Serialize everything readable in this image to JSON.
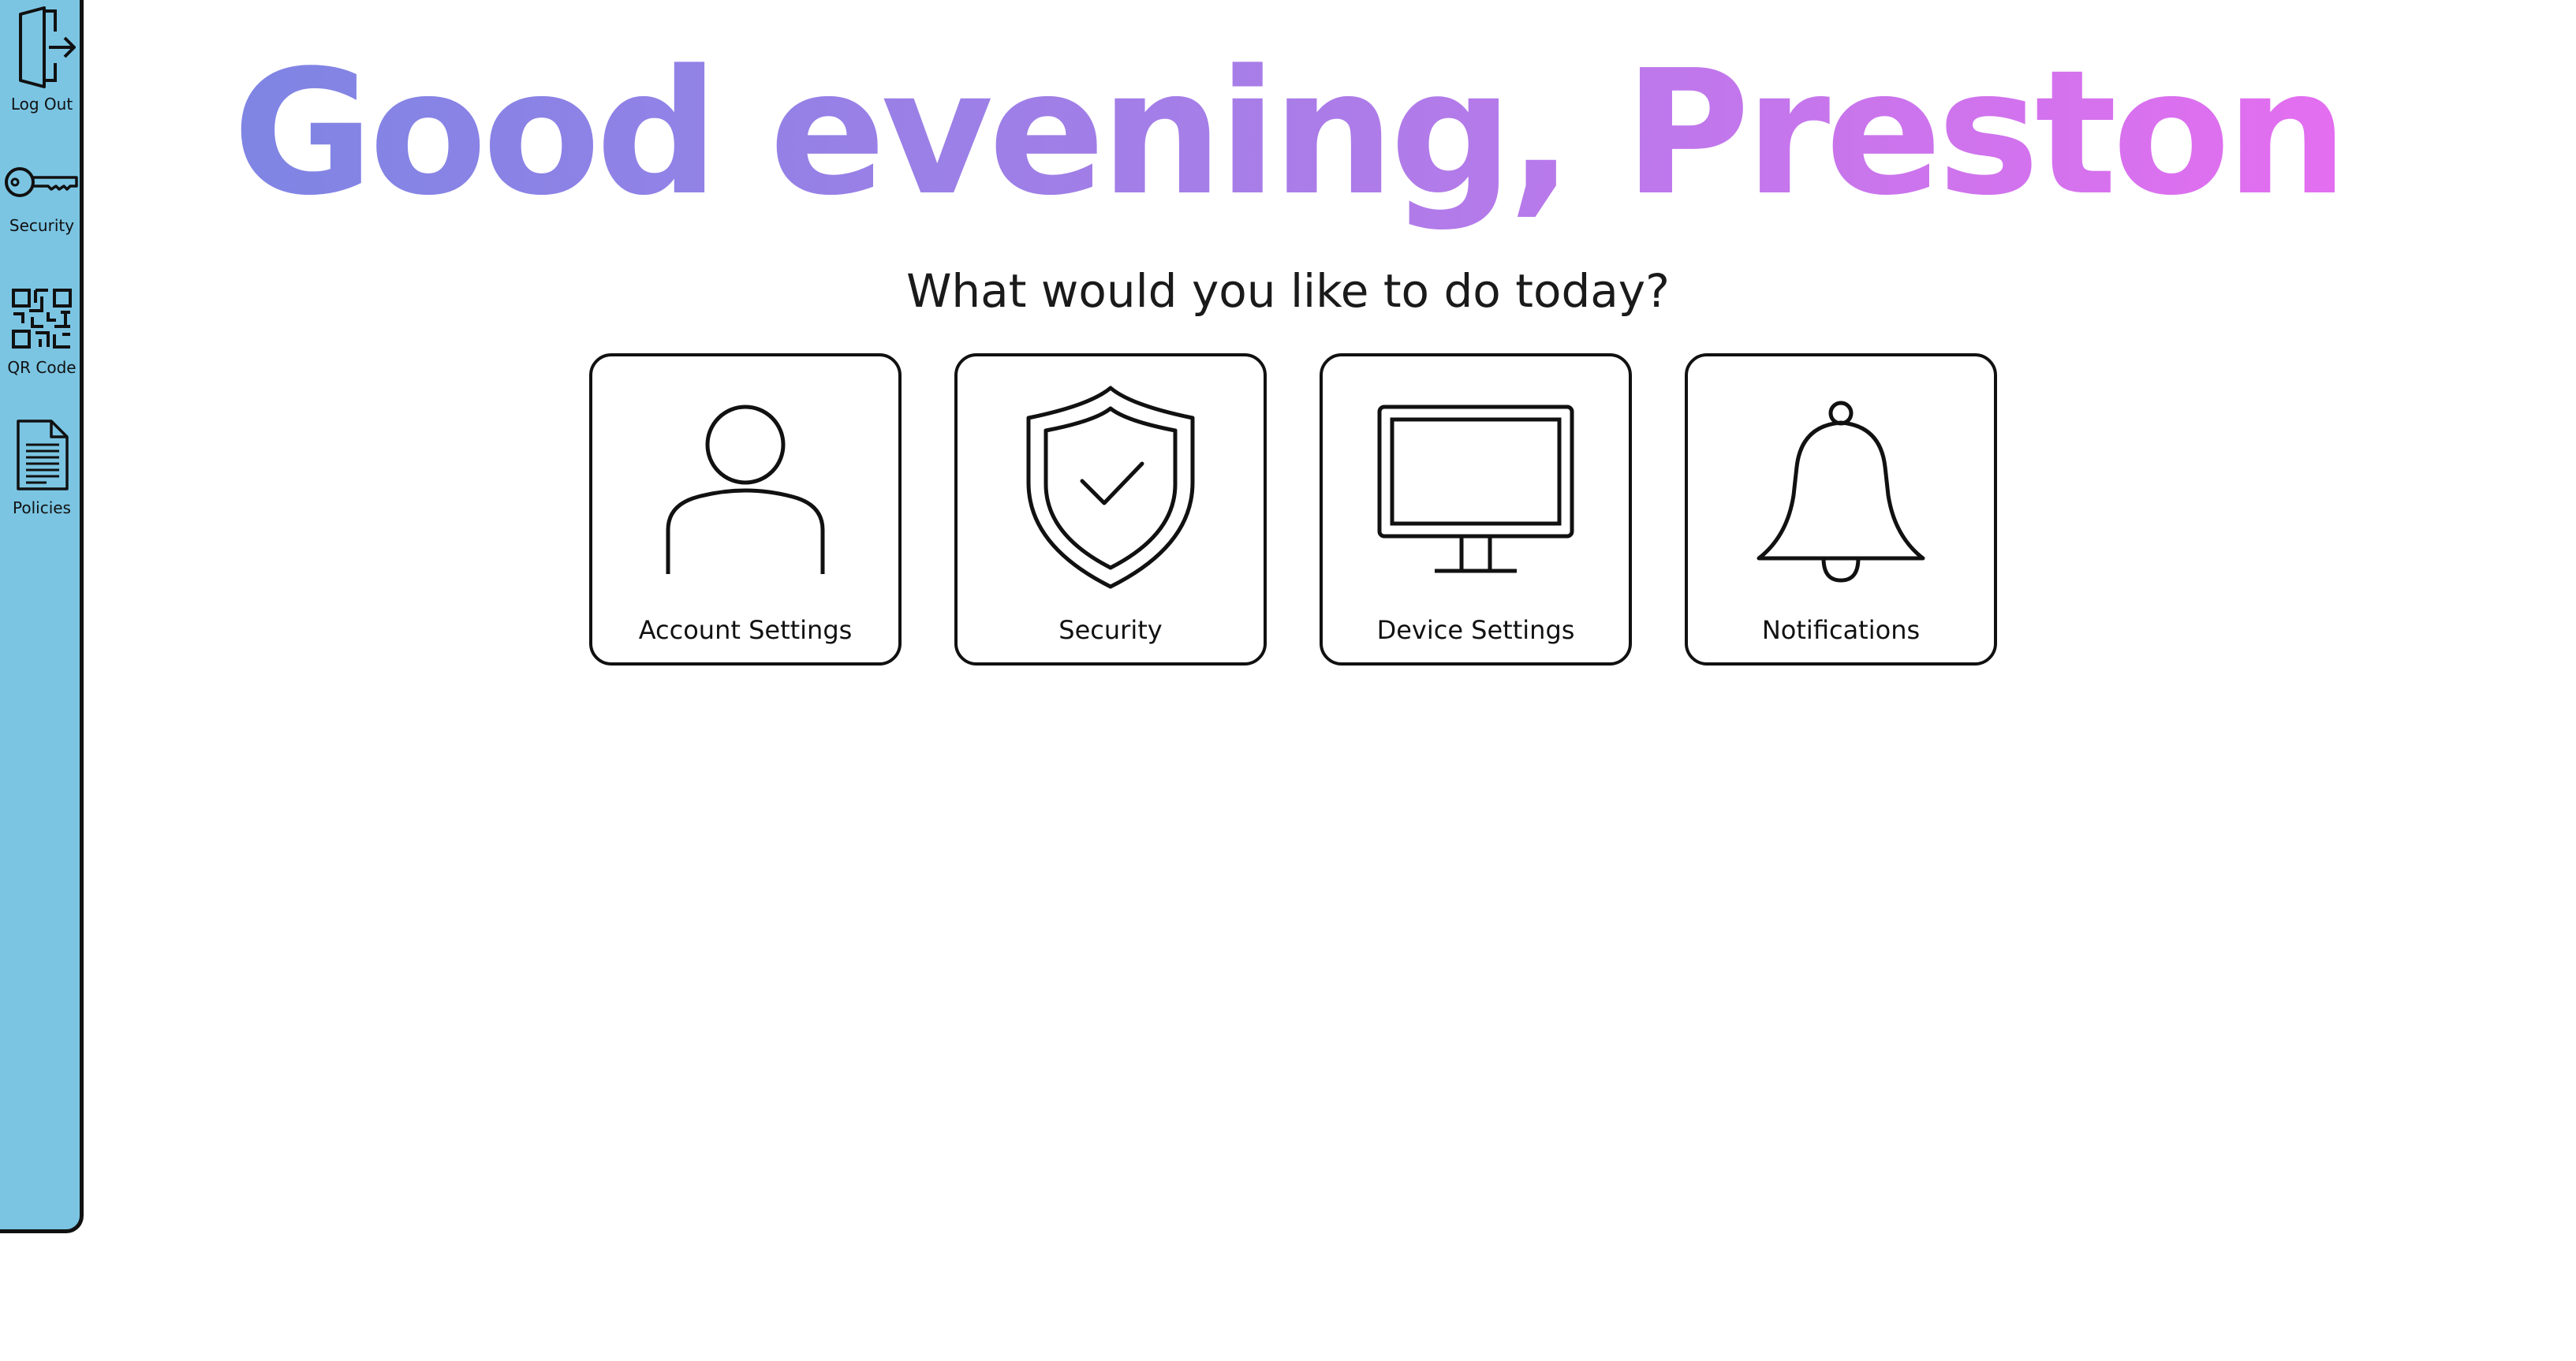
{
  "sidebar": {
    "items": [
      {
        "label": "Log Out",
        "icon": "log-out-icon"
      },
      {
        "label": "Security",
        "icon": "key-icon"
      },
      {
        "label": "QR Code",
        "icon": "qr-code-icon"
      },
      {
        "label": "Policies",
        "icon": "document-icon"
      }
    ],
    "background_color": "#7bc5e3"
  },
  "header": {
    "greeting": "Good evening, Preston",
    "gradient_colors": [
      "#7f85e4",
      "#a97de8",
      "#e46ef0"
    ],
    "prompt": "What would you like to do today?"
  },
  "cards": [
    {
      "label": "Account Settings",
      "icon": "user-icon"
    },
    {
      "label": "Security",
      "icon": "shield-check-icon"
    },
    {
      "label": "Device Settings",
      "icon": "monitor-icon"
    },
    {
      "label": "Notifications",
      "icon": "bell-icon"
    }
  ]
}
